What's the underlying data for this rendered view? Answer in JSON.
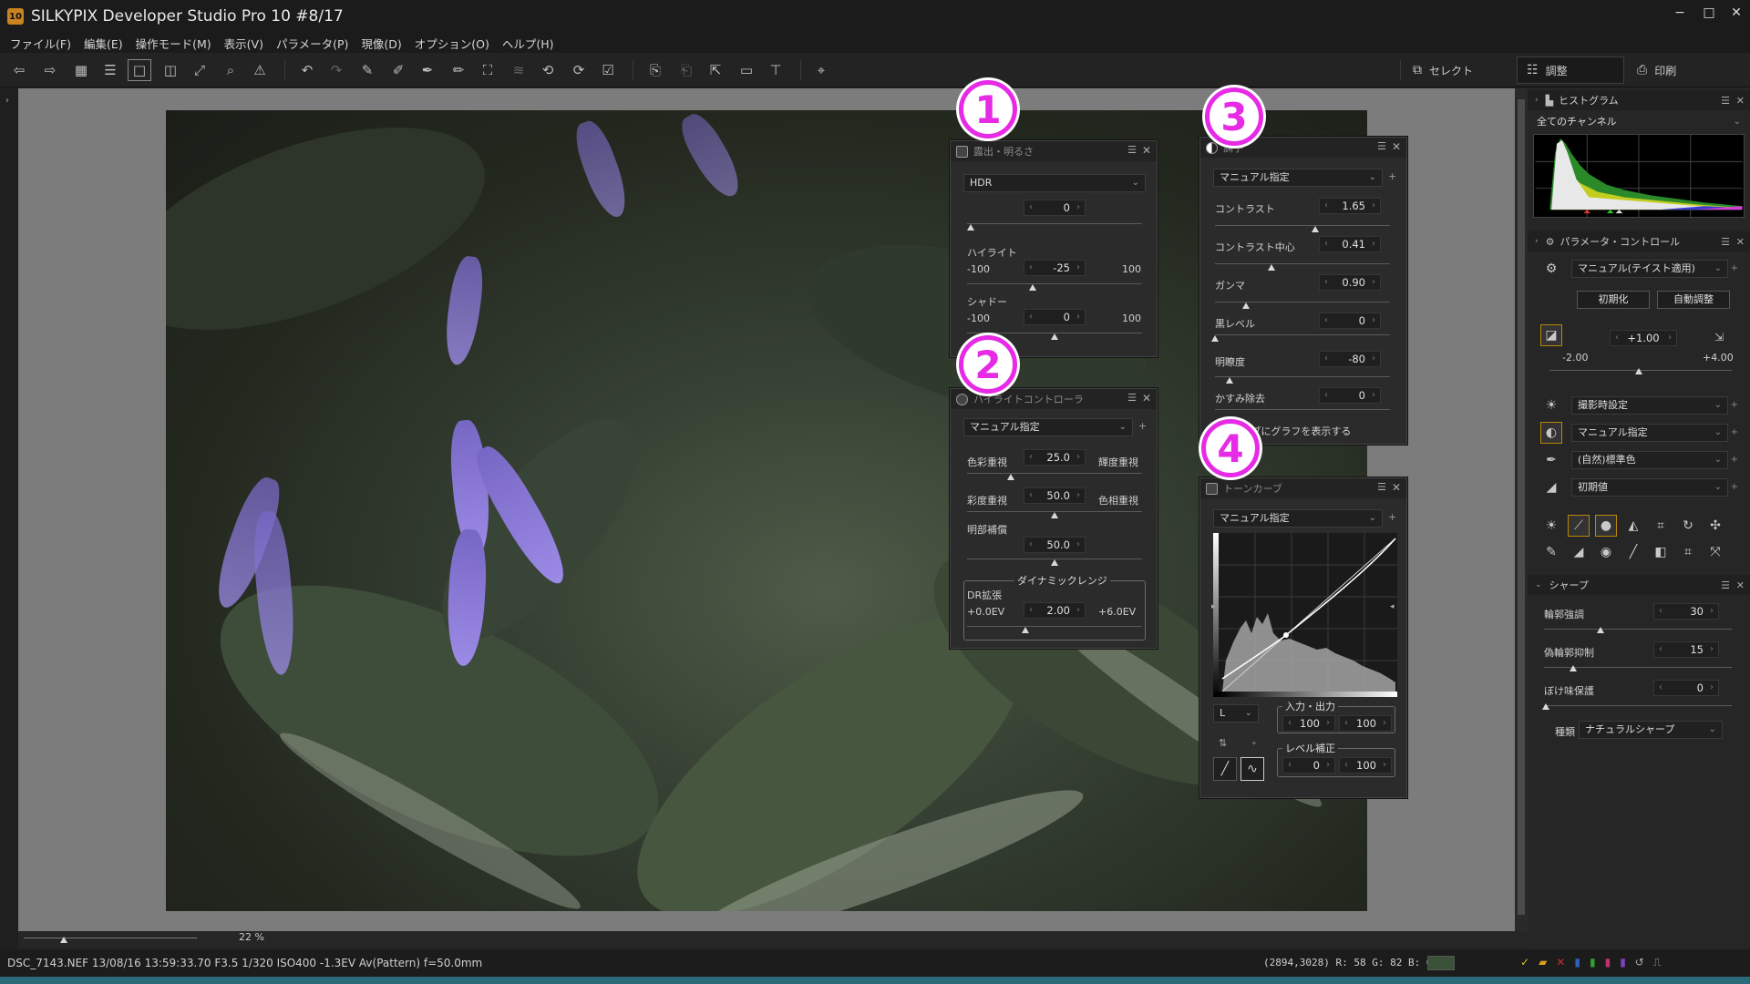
{
  "window": {
    "title": "SILKYPIX Developer Studio Pro 10   #8/17",
    "app_icon": "10",
    "controls": [
      "−",
      "□",
      "✕"
    ]
  },
  "menu": [
    "ファイル(F)",
    "編集(E)",
    "操作モード(M)",
    "表示(V)",
    "パラメータ(P)",
    "現像(D)",
    "オプション(O)",
    "ヘルプ(H)"
  ],
  "mode_tabs": [
    {
      "label": "セレクト",
      "icon": "select-icon"
    },
    {
      "label": "調整",
      "icon": "adjust-icon"
    },
    {
      "label": "印刷",
      "icon": "print-icon"
    }
  ],
  "viewer": {
    "zoom": "22",
    "zoom_unit": "%"
  },
  "status": {
    "file_info": "DSC_7143.NEF 13/08/16 13:59:33.70 F3.5 1/320 ISO400 -1.3EV Av(Pattern) f=50.0mm",
    "coords": "(2894,3028) R: 58 G: 82 B: 63",
    "swatch_color": "#3a523a"
  },
  "badges": [
    "1",
    "2",
    "3",
    "4"
  ],
  "panel_exposure": {
    "title": "露出・明るさ",
    "mode": "HDR",
    "hdr_value": "0",
    "highlight_label": "ハイライト",
    "highlight_min": "-100",
    "highlight_max": "100",
    "highlight_value": "-25",
    "shadow_label": "シャドー",
    "shadow_min": "-100",
    "shadow_max": "100",
    "shadow_value": "0"
  },
  "panel_highlight": {
    "title": "ハイライトコントローラ",
    "mode": "マニュアル指定",
    "color_priority": "色彩重視",
    "luminance_priority": "輝度重視",
    "slider1_value": "25.0",
    "saturation_priority": "彩度重視",
    "hue_priority": "色相重視",
    "slider2_value": "50.0",
    "dark_comp": "明部補償",
    "slider3_value": "50.0",
    "dr_group": "ダイナミックレンジ",
    "dr_label": "DR拡張",
    "dr_min": "+0.0EV",
    "dr_max": "+6.0EV",
    "dr_value": "2.00"
  },
  "panel_tone": {
    "title": "調子",
    "mode": "マニュアル指定",
    "rows": [
      {
        "label": "コントラスト",
        "value": "1.65"
      },
      {
        "label": "コントラスト中心",
        "value": "0.41"
      },
      {
        "label": "ガンマ",
        "value": "0.90"
      },
      {
        "label": "黒レベル",
        "value": "0"
      },
      {
        "label": "明瞭度",
        "value": "-80"
      },
      {
        "label": "かすみ除去",
        "value": "0"
      }
    ],
    "checkbox_label": "カーブにグラフを表示する"
  },
  "panel_curve": {
    "title": "トーンカーブ",
    "mode": "マニュアル指定",
    "channel": "L",
    "io_group": "入力・出力",
    "io_in": "100",
    "io_out": "100",
    "level_group": "レベル補正",
    "level_min": "0",
    "level_max": "100",
    "axis_min": "0",
    "axis_max": "255"
  },
  "right": {
    "histogram_title": "ヒストグラム",
    "histogram_channel": "全てのチャンネル",
    "param_title": "パラメータ・コントロール",
    "taste": "マニュアル(テイスト適用)",
    "reset_btn": "初期化",
    "auto_btn": "自動調整",
    "exposure_value": "+1.00",
    "exposure_min": "-2.00",
    "exposure_max": "+4.00",
    "wb": "撮影時設定",
    "tone_mode": "マニュアル指定",
    "color": "(自然)標準色",
    "sharp_preset": "初期値",
    "sharp_title": "シャープ",
    "sharp_rows": [
      {
        "label": "輪郭強調",
        "value": "30"
      },
      {
        "label": "偽輪郭抑制",
        "value": "15"
      },
      {
        "label": "ぼけ味保護",
        "value": "0"
      }
    ],
    "sharp_type_label": "種類",
    "sharp_type": "ナチュラルシャープ"
  },
  "colors": {
    "accent": "#e62ae6",
    "bottom_line": "#2a6a7a",
    "highlight_border": "#b8860b"
  }
}
